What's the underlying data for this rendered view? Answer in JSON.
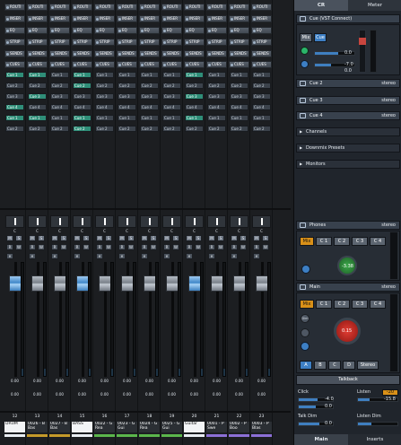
{
  "mixer": {
    "rack_labels": [
      "ROUTI",
      "INSER",
      "EQ",
      "STRIP",
      "SENDS",
      "CUES"
    ],
    "rack_colors": {
      "ROUTI": "#6f7883",
      "INSER": "#6f7883",
      "EQ": "#6a7886",
      "STRIP": "#6f7883",
      "SENDS": "#6f7883",
      "CUES": "#6f7883"
    },
    "cue_labels": [
      "Cue 1",
      "Cue 2",
      "Cue 3",
      "Cue 4",
      "Cue 1",
      "Cue 2",
      "Cue 3",
      "Cue 4"
    ],
    "channels": [
      {
        "name": "DRUM",
        "number": "12",
        "pan": "C",
        "volume": "0.00",
        "bar_color": "#e9eef3",
        "name_bg": "#f2f4f6",
        "name_color": "#111",
        "cue_on": [
          1,
          0,
          0,
          1
        ]
      },
      {
        "name": "0026 - B Bas",
        "number": "13",
        "pan": "C",
        "volume": "0.00",
        "bar_color": "#c59a2a",
        "name_bg": "#2b2f34",
        "name_color": "#fff",
        "cue_on": [
          1,
          0,
          1,
          0
        ]
      },
      {
        "name": "0027 - B Bas",
        "number": "14",
        "pan": "C",
        "volume": "0.00",
        "bar_color": "#c59a2a",
        "name_bg": "#2b2f34",
        "name_color": "#fff",
        "cue_on": [
          0,
          0,
          0,
          0
        ]
      },
      {
        "name": "BASS",
        "number": "15",
        "pan": "C",
        "volume": "0.00",
        "bar_color": "#e9eef3",
        "name_bg": "#f2f4f6",
        "name_color": "#111",
        "cue_on": [
          1,
          1,
          0,
          0
        ]
      },
      {
        "name": "0022 - G Rea",
        "number": "16",
        "pan": "C",
        "volume": "0.00",
        "bar_color": "#5bb64c",
        "name_bg": "#2b2f34",
        "name_color": "#fff",
        "cue_on": [
          0,
          0,
          0,
          0
        ]
      },
      {
        "name": "0023 - G Gui",
        "number": "17",
        "pan": "C",
        "volume": "0.00",
        "bar_color": "#5bb64c",
        "name_bg": "#2b2f34",
        "name_color": "#fff",
        "cue_on": [
          0,
          0,
          0,
          0
        ]
      },
      {
        "name": "0024 - G Rea",
        "number": "18",
        "pan": "C",
        "volume": "0.00",
        "bar_color": "#5bb64c",
        "name_bg": "#2b2f34",
        "name_color": "#fff",
        "cue_on": [
          0,
          0,
          0,
          0
        ]
      },
      {
        "name": "0025 - G Gui",
        "number": "19",
        "pan": "C",
        "volume": "0.00",
        "bar_color": "#5bb64c",
        "name_bg": "#2b2f34",
        "name_color": "#fff",
        "cue_on": [
          0,
          0,
          0,
          0
        ]
      },
      {
        "name": "Guitar",
        "number": "20",
        "pan": "C",
        "volume": "0.00",
        "bar_color": "#e9eef3",
        "name_bg": "#f2f4f6",
        "name_color": "#111",
        "cue_on": [
          1,
          0,
          1,
          0
        ]
      },
      {
        "name": "0001 - P Swe",
        "number": "21",
        "pan": "C",
        "volume": "0.00",
        "bar_color": "#8b6fd6",
        "name_bg": "#2b2f34",
        "name_color": "#fff",
        "cue_on": [
          0,
          0,
          0,
          0
        ]
      },
      {
        "name": "0002 - P Boo",
        "number": "22",
        "pan": "C",
        "volume": "0.00",
        "bar_color": "#8b6fd6",
        "name_bg": "#2b2f34",
        "name_color": "#fff",
        "cue_on": [
          0,
          0,
          0,
          0
        ]
      },
      {
        "name": "0003 - P Blas",
        "number": "23",
        "pan": "C",
        "volume": "0.00",
        "bar_color": "#8b6fd6",
        "name_bg": "#2b2f34",
        "name_color": "#fff",
        "cue_on": [
          0,
          0,
          0,
          0
        ]
      }
    ],
    "rw_labels": {
      "r": "R",
      "w": "W",
      "m": "M",
      "s": "S",
      "e": "e"
    }
  },
  "control_room": {
    "tabs": {
      "cr": "CR",
      "meter": "Meter"
    },
    "cue1": {
      "label": "Cue (VST Connect)",
      "mix": "Mix",
      "cue": "Cue",
      "value1": "0.0",
      "value2": "-7.0",
      "value3": "0.0"
    },
    "cue_rows": [
      {
        "label": "Cue 2",
        "status": "stereo"
      },
      {
        "label": "Cue 3",
        "status": "stereo"
      },
      {
        "label": "Cue 4",
        "status": "stereo"
      }
    ],
    "sections": [
      "Channels",
      "Downmix Presets",
      "Monitors"
    ],
    "phones": {
      "label": "Phones",
      "status": "stereo",
      "mix": "Mix",
      "c1": "C 1",
      "c2": "C 2",
      "c3": "C 3",
      "c4": "C 4",
      "knob_value": "-3.38"
    },
    "main": {
      "label": "Main",
      "status": "stereo",
      "mix": "Mix",
      "c1": "C 1",
      "c2": "C 2",
      "c3": "C 3",
      "c4": "C 4",
      "knob_value": "0.15",
      "dim": "Dim",
      "a": "A",
      "b": "B",
      "c": "C",
      "d": "D",
      "stereo": "Stereo"
    },
    "talkback": "Talkback",
    "click": {
      "label": "Click",
      "value1": "-4.0",
      "value2": "0.0"
    },
    "listen": {
      "label": "Listen",
      "value1": "-20",
      "value2": "-15.8"
    },
    "listen_dim": {
      "label": "Listen Dim"
    },
    "talk_dim": {
      "label": "Talk Dim",
      "value": "0.0"
    },
    "bottom_tabs": {
      "main": "Main",
      "inserts": "Inserts"
    },
    "colors": {
      "orange": "#d99018",
      "blue": "#3d7fc4",
      "green": "#34a853",
      "red": "#d4302a"
    }
  }
}
